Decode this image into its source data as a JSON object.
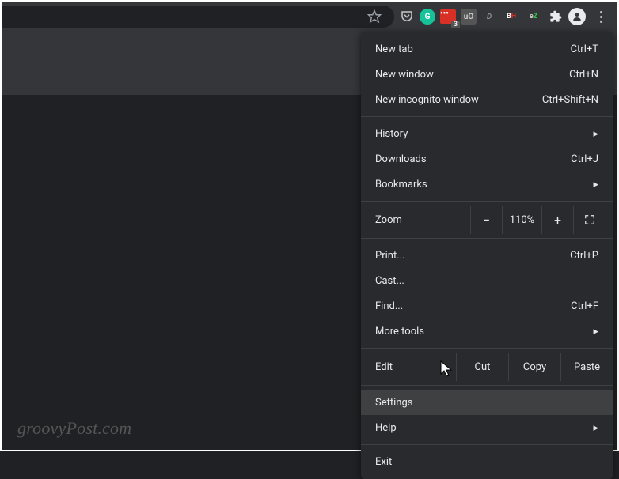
{
  "toolbar": {
    "extensions": {
      "grammarly_letter": "G",
      "red_badge": "3",
      "ublock_label": "uO",
      "dusk_label": "D",
      "bh_b": "B",
      "bh_h": "H",
      "ez_e": "e",
      "ez_z": "Z"
    }
  },
  "menu": {
    "new_tab": {
      "label": "New tab",
      "shortcut": "Ctrl+T"
    },
    "new_window": {
      "label": "New window",
      "shortcut": "Ctrl+N"
    },
    "new_incognito": {
      "label": "New incognito window",
      "shortcut": "Ctrl+Shift+N"
    },
    "history": {
      "label": "History"
    },
    "downloads": {
      "label": "Downloads",
      "shortcut": "Ctrl+J"
    },
    "bookmarks": {
      "label": "Bookmarks"
    },
    "zoom": {
      "label": "Zoom",
      "value": "110%",
      "minus": "−",
      "plus": "+"
    },
    "print": {
      "label": "Print...",
      "shortcut": "Ctrl+P"
    },
    "cast": {
      "label": "Cast..."
    },
    "find": {
      "label": "Find...",
      "shortcut": "Ctrl+F"
    },
    "more_tools": {
      "label": "More tools"
    },
    "edit": {
      "label": "Edit",
      "cut": "Cut",
      "copy": "Copy",
      "paste": "Paste"
    },
    "settings": {
      "label": "Settings"
    },
    "help": {
      "label": "Help"
    },
    "exit": {
      "label": "Exit"
    }
  },
  "watermark": "groovyPost.com"
}
